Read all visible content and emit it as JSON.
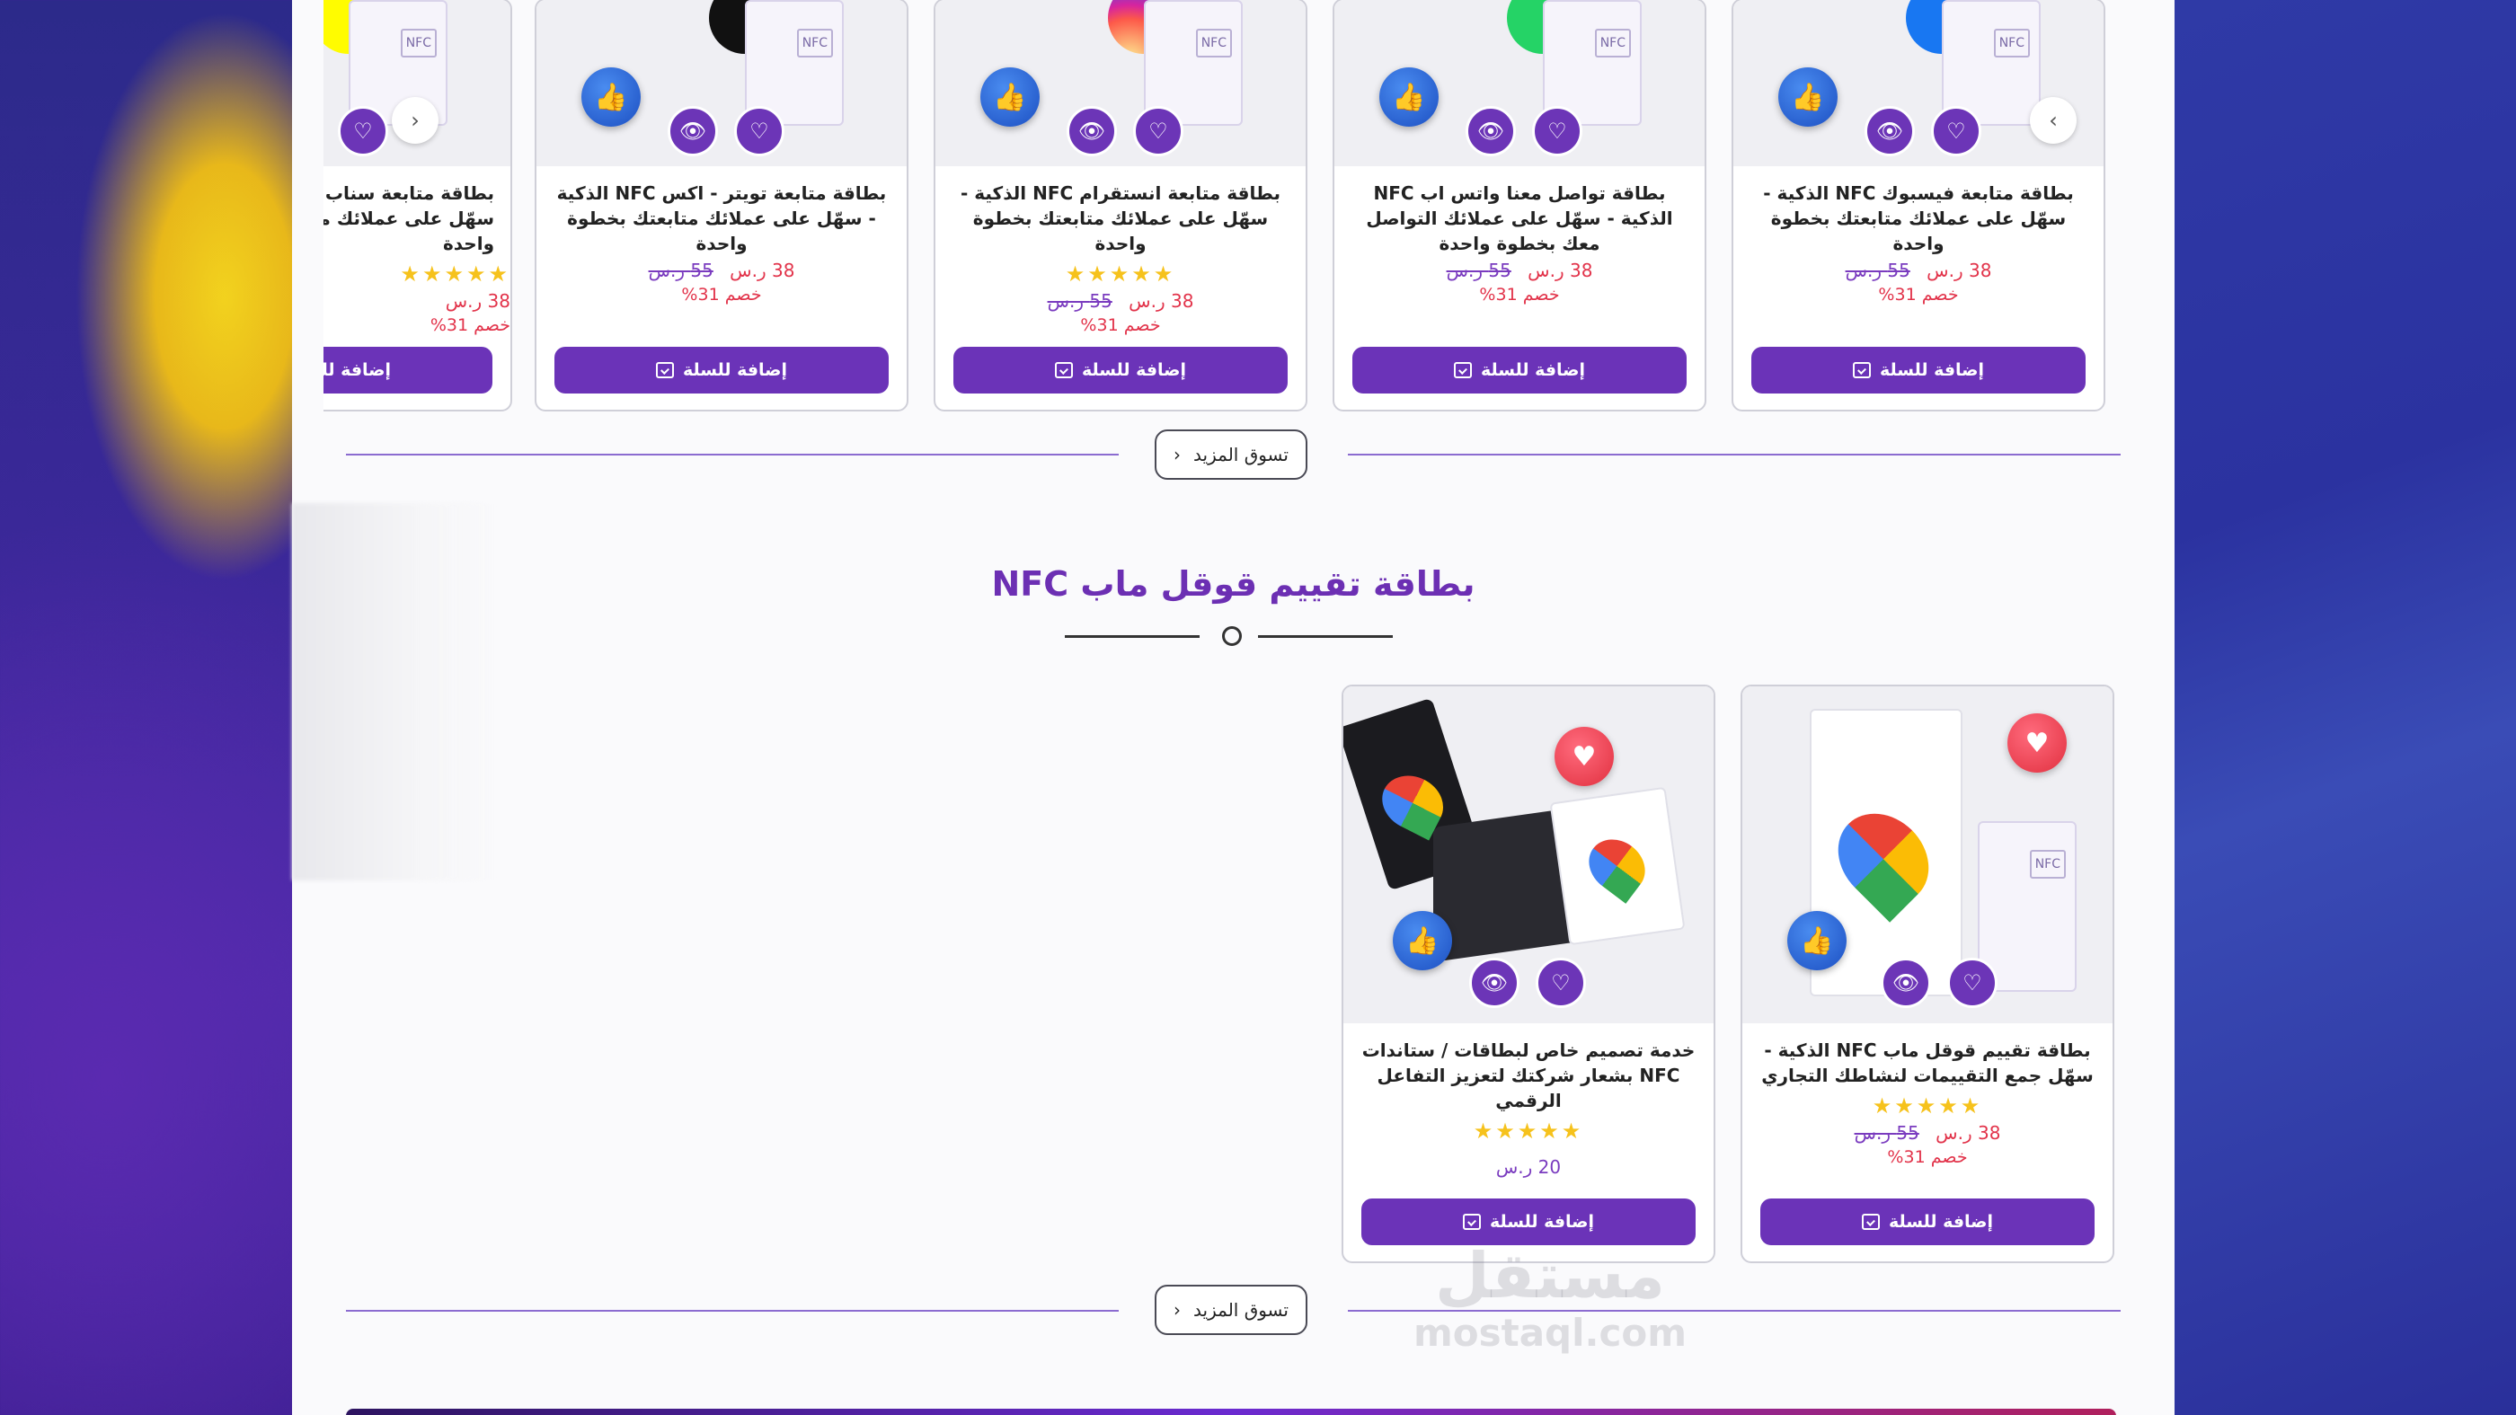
{
  "top_row": {
    "cards": [
      {
        "title": "بطاقة متابعة فيسبوك NFC الذكية - سهّل على عملائك متابعتك بخطوة واحدة",
        "stars": "",
        "price_new": "38 ر.س",
        "price_old": "55 ر.س",
        "discount": "خصم 31%",
        "cart_label": "إضافة للسلة",
        "brand_color": "#1877f2"
      },
      {
        "title": "بطاقة تواصل معنا واتس اب NFC الذكية - سهّل على عملائك التواصل معك بخطوة واحدة",
        "stars": "",
        "price_new": "38 ر.س",
        "price_old": "55 ر.س",
        "discount": "خصم 31%",
        "cart_label": "إضافة للسلة",
        "brand_color": "#25d366"
      },
      {
        "title": "بطاقة متابعة انستقرام NFC الذكية - سهّل على عملائك متابعتك بخطوة واحدة",
        "stars": "★★★★★",
        "price_new": "38 ر.س",
        "price_old": "55 ر.س",
        "discount": "خصم 31%",
        "cart_label": "إضافة للسلة",
        "brand_color": "#e4405f"
      },
      {
        "title": "بطاقة متابعة تويتر - اكس NFC الذكية - سهّل على عملائك متابعتك بخطوة واحدة",
        "stars": "",
        "price_new": "38 ر.س",
        "price_old": "55 ر.س",
        "discount": "خصم 31%",
        "cart_label": "إضافة للسلة",
        "brand_color": "#111111"
      },
      {
        "title": "بطاقة متابعة سناب NFC الذكية - سهّل على عملائك متابعتك بخطوة واحدة",
        "stars": "★★★★★",
        "price_new": "38 ر.س",
        "price_old": "",
        "discount": "خصم 31%",
        "cart_label": "إضافة للسلة",
        "brand_color": "#fffc00"
      }
    ],
    "more_label": "تسوق المزيد"
  },
  "section": {
    "title": "بطاقة تقييم قوقل ماب NFC"
  },
  "bottom_row": {
    "cards": [
      {
        "title": "بطاقة تقييم قوقل ماب NFC الذكية - سهّل جمع التقييمات لنشاطك التجاري",
        "stars": "★★★★★",
        "price_new": "38 ر.س",
        "price_old": "55 ر.س",
        "discount": "خصم 31%",
        "cart_label": "إضافة للسلة"
      },
      {
        "title": "خدمة تصميم خاص لبطاقات / ستاندات NFC بشعار شركتك لتعزيز التفاعل الرقمي",
        "stars": "★★★★★",
        "price": "20 ر.س",
        "cart_label": "إضافة للسلة"
      }
    ],
    "more_label": "تسوق المزيد"
  },
  "watermark": {
    "line1": "مستقل",
    "line2": "mostaql.com"
  },
  "icons": {
    "like": "thumbs-up-icon",
    "heart": "heart-icon",
    "eye": "eye-icon",
    "cart": "cart-icon",
    "chevron": "chevron-icon"
  },
  "colors": {
    "primary": "#6b33b8",
    "price_new": "#e2334a",
    "price_old": "#7a3bbf",
    "star": "#f6c21c"
  }
}
